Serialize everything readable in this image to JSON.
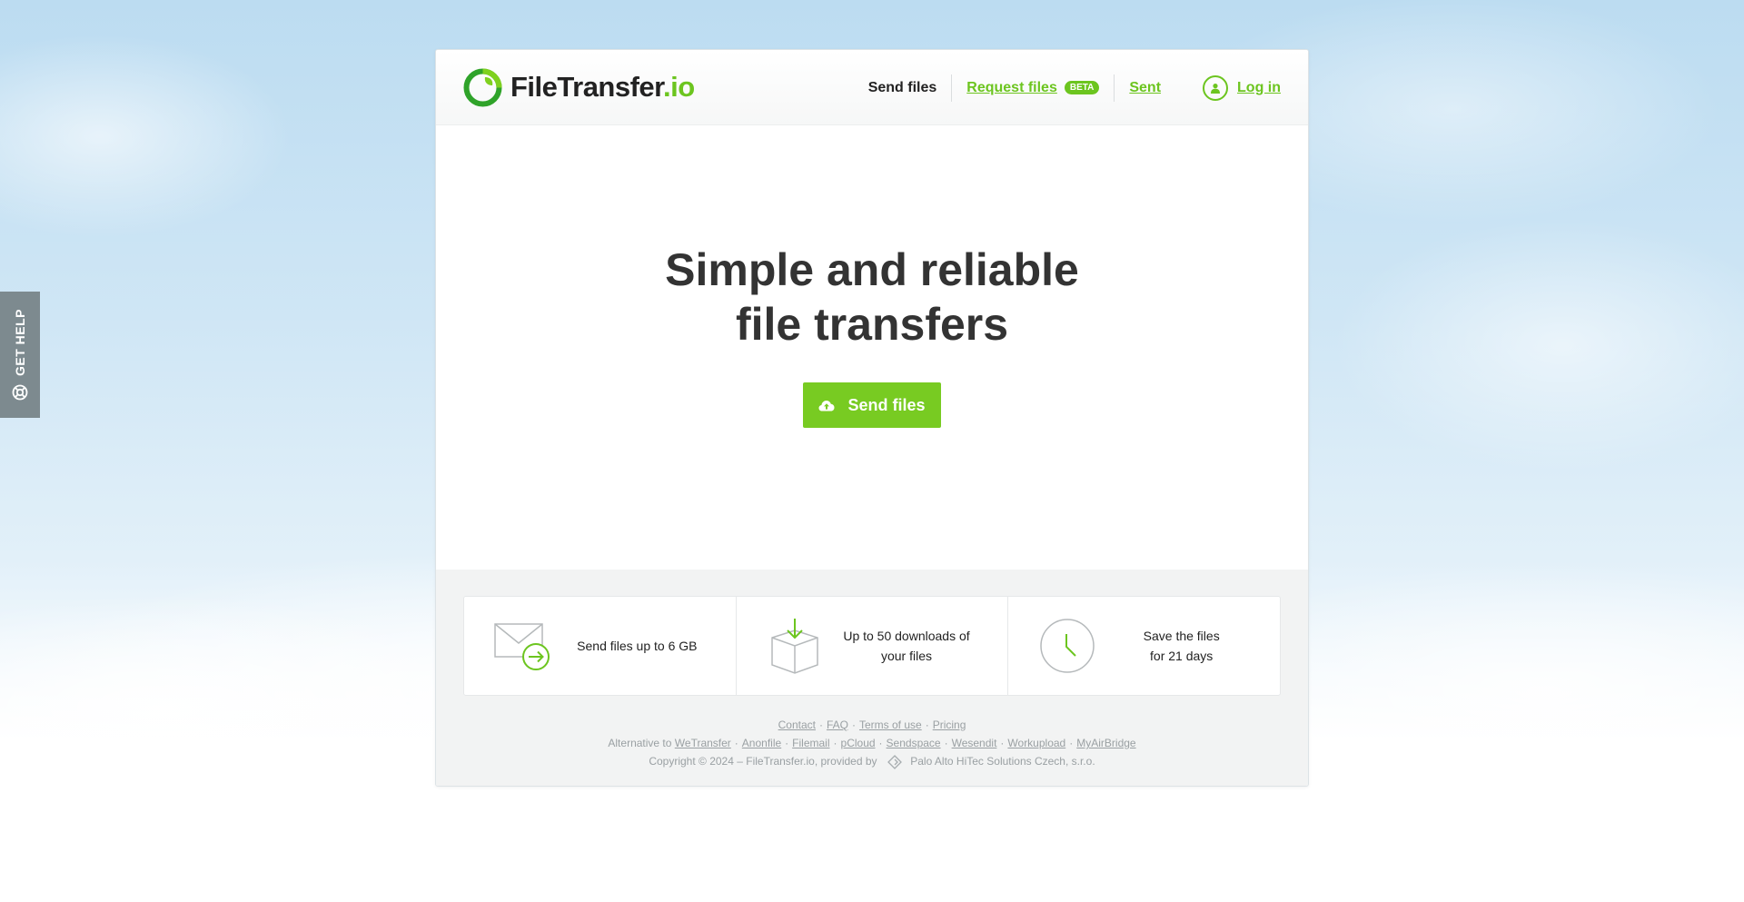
{
  "help_tab": {
    "label": "GET HELP"
  },
  "logo": {
    "name": "FileTransfer",
    "tld": ".io"
  },
  "nav": {
    "send_files": "Send files",
    "request_files": "Request files",
    "beta": "BETA",
    "sent": "Sent",
    "login": "Log in"
  },
  "hero": {
    "line1": "Simple and reliable",
    "line2": "file transfers",
    "button_label": "Send files"
  },
  "features": [
    {
      "icon": "envelope-send-icon",
      "line1": "Send files up to 6 GB",
      "line2": ""
    },
    {
      "icon": "box-download-icon",
      "line1": "Up to 50 downloads of",
      "line2": "your files"
    },
    {
      "icon": "clock-icon",
      "line1": "Save the files",
      "line2": "for 21 days"
    }
  ],
  "footer": {
    "links": [
      "Contact",
      "FAQ",
      "Terms of use",
      "Pricing"
    ],
    "alternative_prefix": "Alternative to",
    "alternatives": [
      "WeTransfer",
      "Anonfile",
      "Filemail",
      "pCloud",
      "Sendspace",
      "Wesendit",
      "Workupload",
      "MyAirBridge"
    ],
    "copyright": "Copyright © 2024 – FileTransfer.io, provided by",
    "provider": "Palo Alto HiTec Solutions Czech, s.r.o."
  },
  "colors": {
    "accent": "#6cc51f",
    "button": "#78cb22",
    "help_tab": "#7d8a8f"
  }
}
